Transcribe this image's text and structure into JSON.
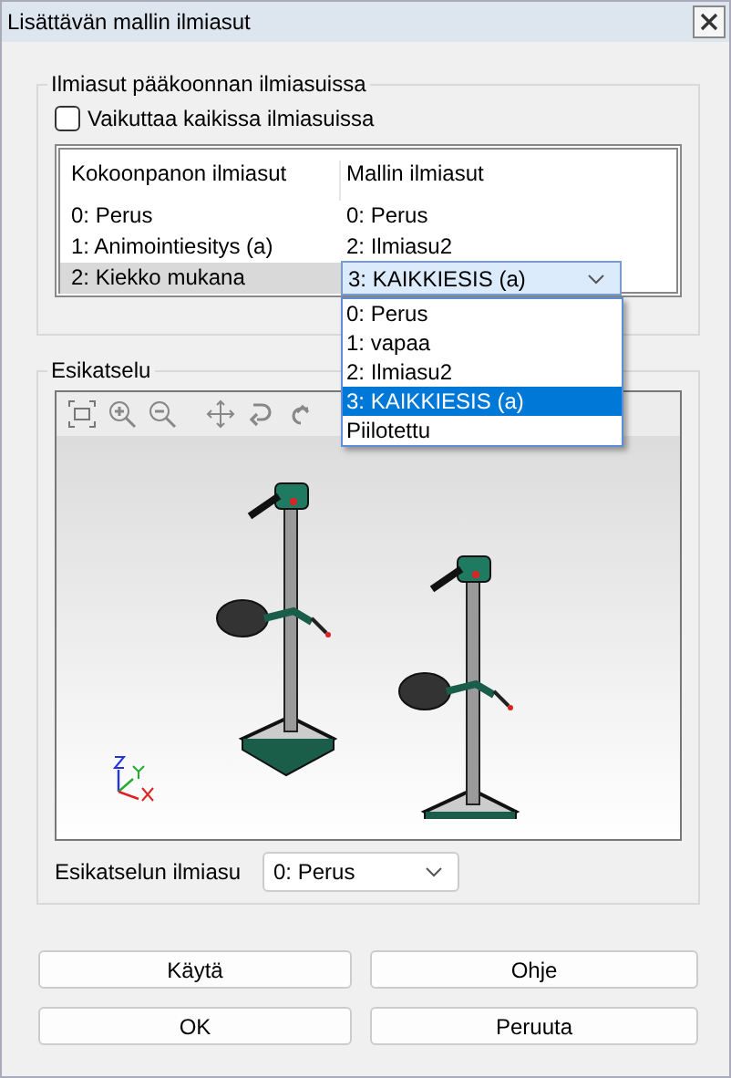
{
  "window": {
    "title": "Lisättävän mallin ilmiasut"
  },
  "top_group": {
    "title": "Ilmiasut pääkoonnan ilmiasuissa",
    "checkbox": {
      "label": "Vaikuttaa kaikissa ilmiasuissa",
      "checked": false
    },
    "table": {
      "columns": [
        "Kokoonpanon ilmiasut",
        "Mallin ilmiasut"
      ],
      "rows": [
        {
          "cells": [
            "0: Perus",
            "0: Perus"
          ],
          "selected": false
        },
        {
          "cells": [
            "1: Animointiesitys (a)",
            "2: Ilmiasu2"
          ],
          "selected": false
        },
        {
          "cells": [
            "2: Kiekko mukana",
            "3: KAIKKIESIS (a)"
          ],
          "selected": true
        }
      ]
    },
    "dropdown_options": [
      {
        "label": "0: Perus",
        "selected": false
      },
      {
        "label": "1: vapaa",
        "selected": false
      },
      {
        "label": "2: Ilmiasu2",
        "selected": false
      },
      {
        "label": "3: KAIKKIESIS (a)",
        "selected": true
      },
      {
        "label": "Piilotettu",
        "selected": false
      }
    ]
  },
  "preview": {
    "title": "Esikatselu",
    "label": "Esikatselun ilmiasu",
    "value": "0: Perus"
  },
  "buttons": [
    "Käytä",
    "Ohje",
    "OK",
    "Peruuta"
  ]
}
